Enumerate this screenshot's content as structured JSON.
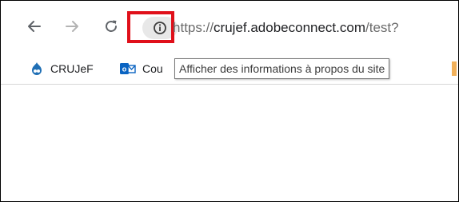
{
  "browser": {
    "nav": {
      "back_icon": "arrow-left-icon",
      "forward_icon": "arrow-right-icon",
      "reload_icon": "reload-icon"
    },
    "address_bar": {
      "site_info_icon": "info-circle-icon",
      "url_scheme_partial": "h",
      "url_rest_prefix": "ttps://",
      "url_host": "crujef.adobeconnect.com",
      "url_path": "/test?"
    },
    "tooltip": {
      "text": "Afficher des informations à propos du site"
    },
    "bookmarks": [
      {
        "label": "CRUJeF",
        "icon": "drupal-icon"
      },
      {
        "label": "Cou",
        "icon": "outlook-icon"
      }
    ]
  },
  "colors": {
    "highlight": "#e0101a",
    "pill": "#e8e8e8",
    "url_dim": "#6b6b6b",
    "url_host": "#202124"
  }
}
